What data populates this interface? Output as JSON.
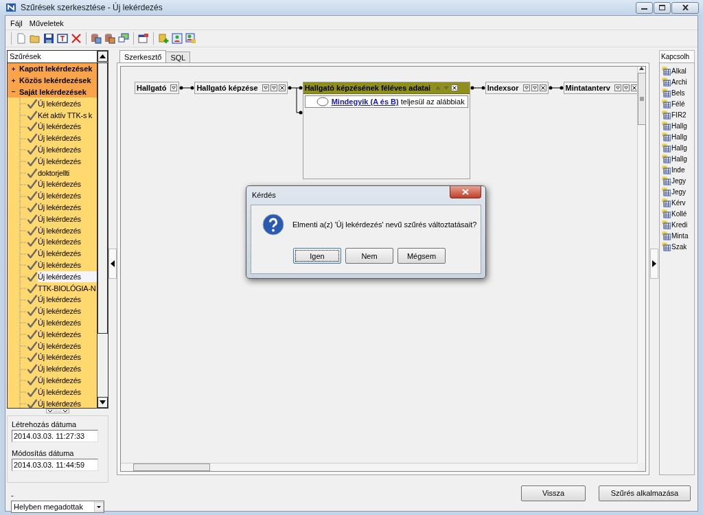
{
  "window": {
    "title": "Szűrések szerkesztése - Új lekérdezés"
  },
  "menu": [
    {
      "label": "Fájl"
    },
    {
      "label": "Műveletek"
    }
  ],
  "filters": {
    "title": "Szűrések",
    "groups": [
      {
        "label": "Kapott lekérdezések",
        "expanded": false
      },
      {
        "label": "Közös lekérdezések",
        "expanded": false
      },
      {
        "label": "Saját lekérdezések",
        "expanded": true,
        "children": [
          {
            "label": "Új lekérdezés",
            "selected": false
          },
          {
            "label": "Két aktív TTK-s k",
            "selected": false
          },
          {
            "label": "Új lekérdezés",
            "selected": false
          },
          {
            "label": "Új lekérdezés",
            "selected": false
          },
          {
            "label": "Új lekérdezés",
            "selected": false
          },
          {
            "label": "Új lekérdezés",
            "selected": false
          },
          {
            "label": "doktorjellti",
            "selected": false
          },
          {
            "label": "Új lekérdezés",
            "selected": false
          },
          {
            "label": "Új lekérdezés",
            "selected": false
          },
          {
            "label": "Új lekérdezés",
            "selected": false
          },
          {
            "label": "Új lekérdezés",
            "selected": false
          },
          {
            "label": "Új lekérdezés",
            "selected": false
          },
          {
            "label": "Új lekérdezés",
            "selected": false
          },
          {
            "label": "Új lekérdezés",
            "selected": false
          },
          {
            "label": "Új lekérdezés",
            "selected": false
          },
          {
            "label": "Új lekérdezés",
            "selected": true
          },
          {
            "label": "TTK-BIOLÓGIA-N",
            "selected": false
          },
          {
            "label": "Új lekérdezés",
            "selected": false
          },
          {
            "label": "Új lekérdezés",
            "selected": false
          },
          {
            "label": "Új lekérdezés",
            "selected": false
          },
          {
            "label": "Új lekérdezés",
            "selected": false
          },
          {
            "label": "Új lekérdezés",
            "selected": false
          },
          {
            "label": "Új lekérdezés",
            "selected": false
          },
          {
            "label": "Új lekérdezés",
            "selected": false
          },
          {
            "label": "Új lekérdezés",
            "selected": false
          },
          {
            "label": "Új lekérdezés",
            "selected": false
          },
          {
            "label": "Új lekérdezés",
            "selected": false
          }
        ]
      }
    ]
  },
  "created": {
    "label": "Létrehozás dátuma",
    "value": "2014.03.03. 11:27:33"
  },
  "modified": {
    "label": "Módosítás dátuma",
    "value": "2014.03.03. 11:44:59"
  },
  "source": {
    "label": "-",
    "value": "Helyben megadottak"
  },
  "tabs": [
    {
      "label": "Szerkesztő",
      "selected": true
    },
    {
      "label": "SQL",
      "selected": false
    }
  ],
  "entities": [
    {
      "name": "Hallgató",
      "kind": "root",
      "selected": false
    },
    {
      "name": "Hallgató képzése",
      "kind": "joined",
      "selected": false
    },
    {
      "name": "Hallgató képzésének féléves adatai",
      "kind": "joined",
      "selected": true,
      "condition": {
        "operator": "Mindegyik (A és B)",
        "text": "teljesül az alábbiak"
      }
    },
    {
      "name": "Indexsor",
      "kind": "joined",
      "selected": false
    },
    {
      "name": "Mintatanterv",
      "kind": "joined",
      "selected": false
    }
  ],
  "tables": {
    "title": "Kapcsolh",
    "items": [
      "Alkal",
      "Archi",
      "Bels",
      "Félé",
      "FIR2",
      "Hallg",
      "Hallg",
      "Hallg",
      "Hallg",
      "Inde",
      "Jegy",
      "Jegy",
      "Kérv",
      "Kollé",
      "Kredi",
      "Minta",
      "Szak"
    ]
  },
  "buttons": [
    {
      "label": "Vissza"
    },
    {
      "label": "Szűrés alkalmazása"
    }
  ],
  "dialog": {
    "title": "Kérdés",
    "message": "Elmenti a(z) 'Új lekérdezés' nevű szűrés változtatásait?",
    "buttons": [
      {
        "label": "Igen",
        "default": true
      },
      {
        "label": "Nem",
        "default": false
      },
      {
        "label": "Mégsem",
        "default": false
      }
    ]
  }
}
